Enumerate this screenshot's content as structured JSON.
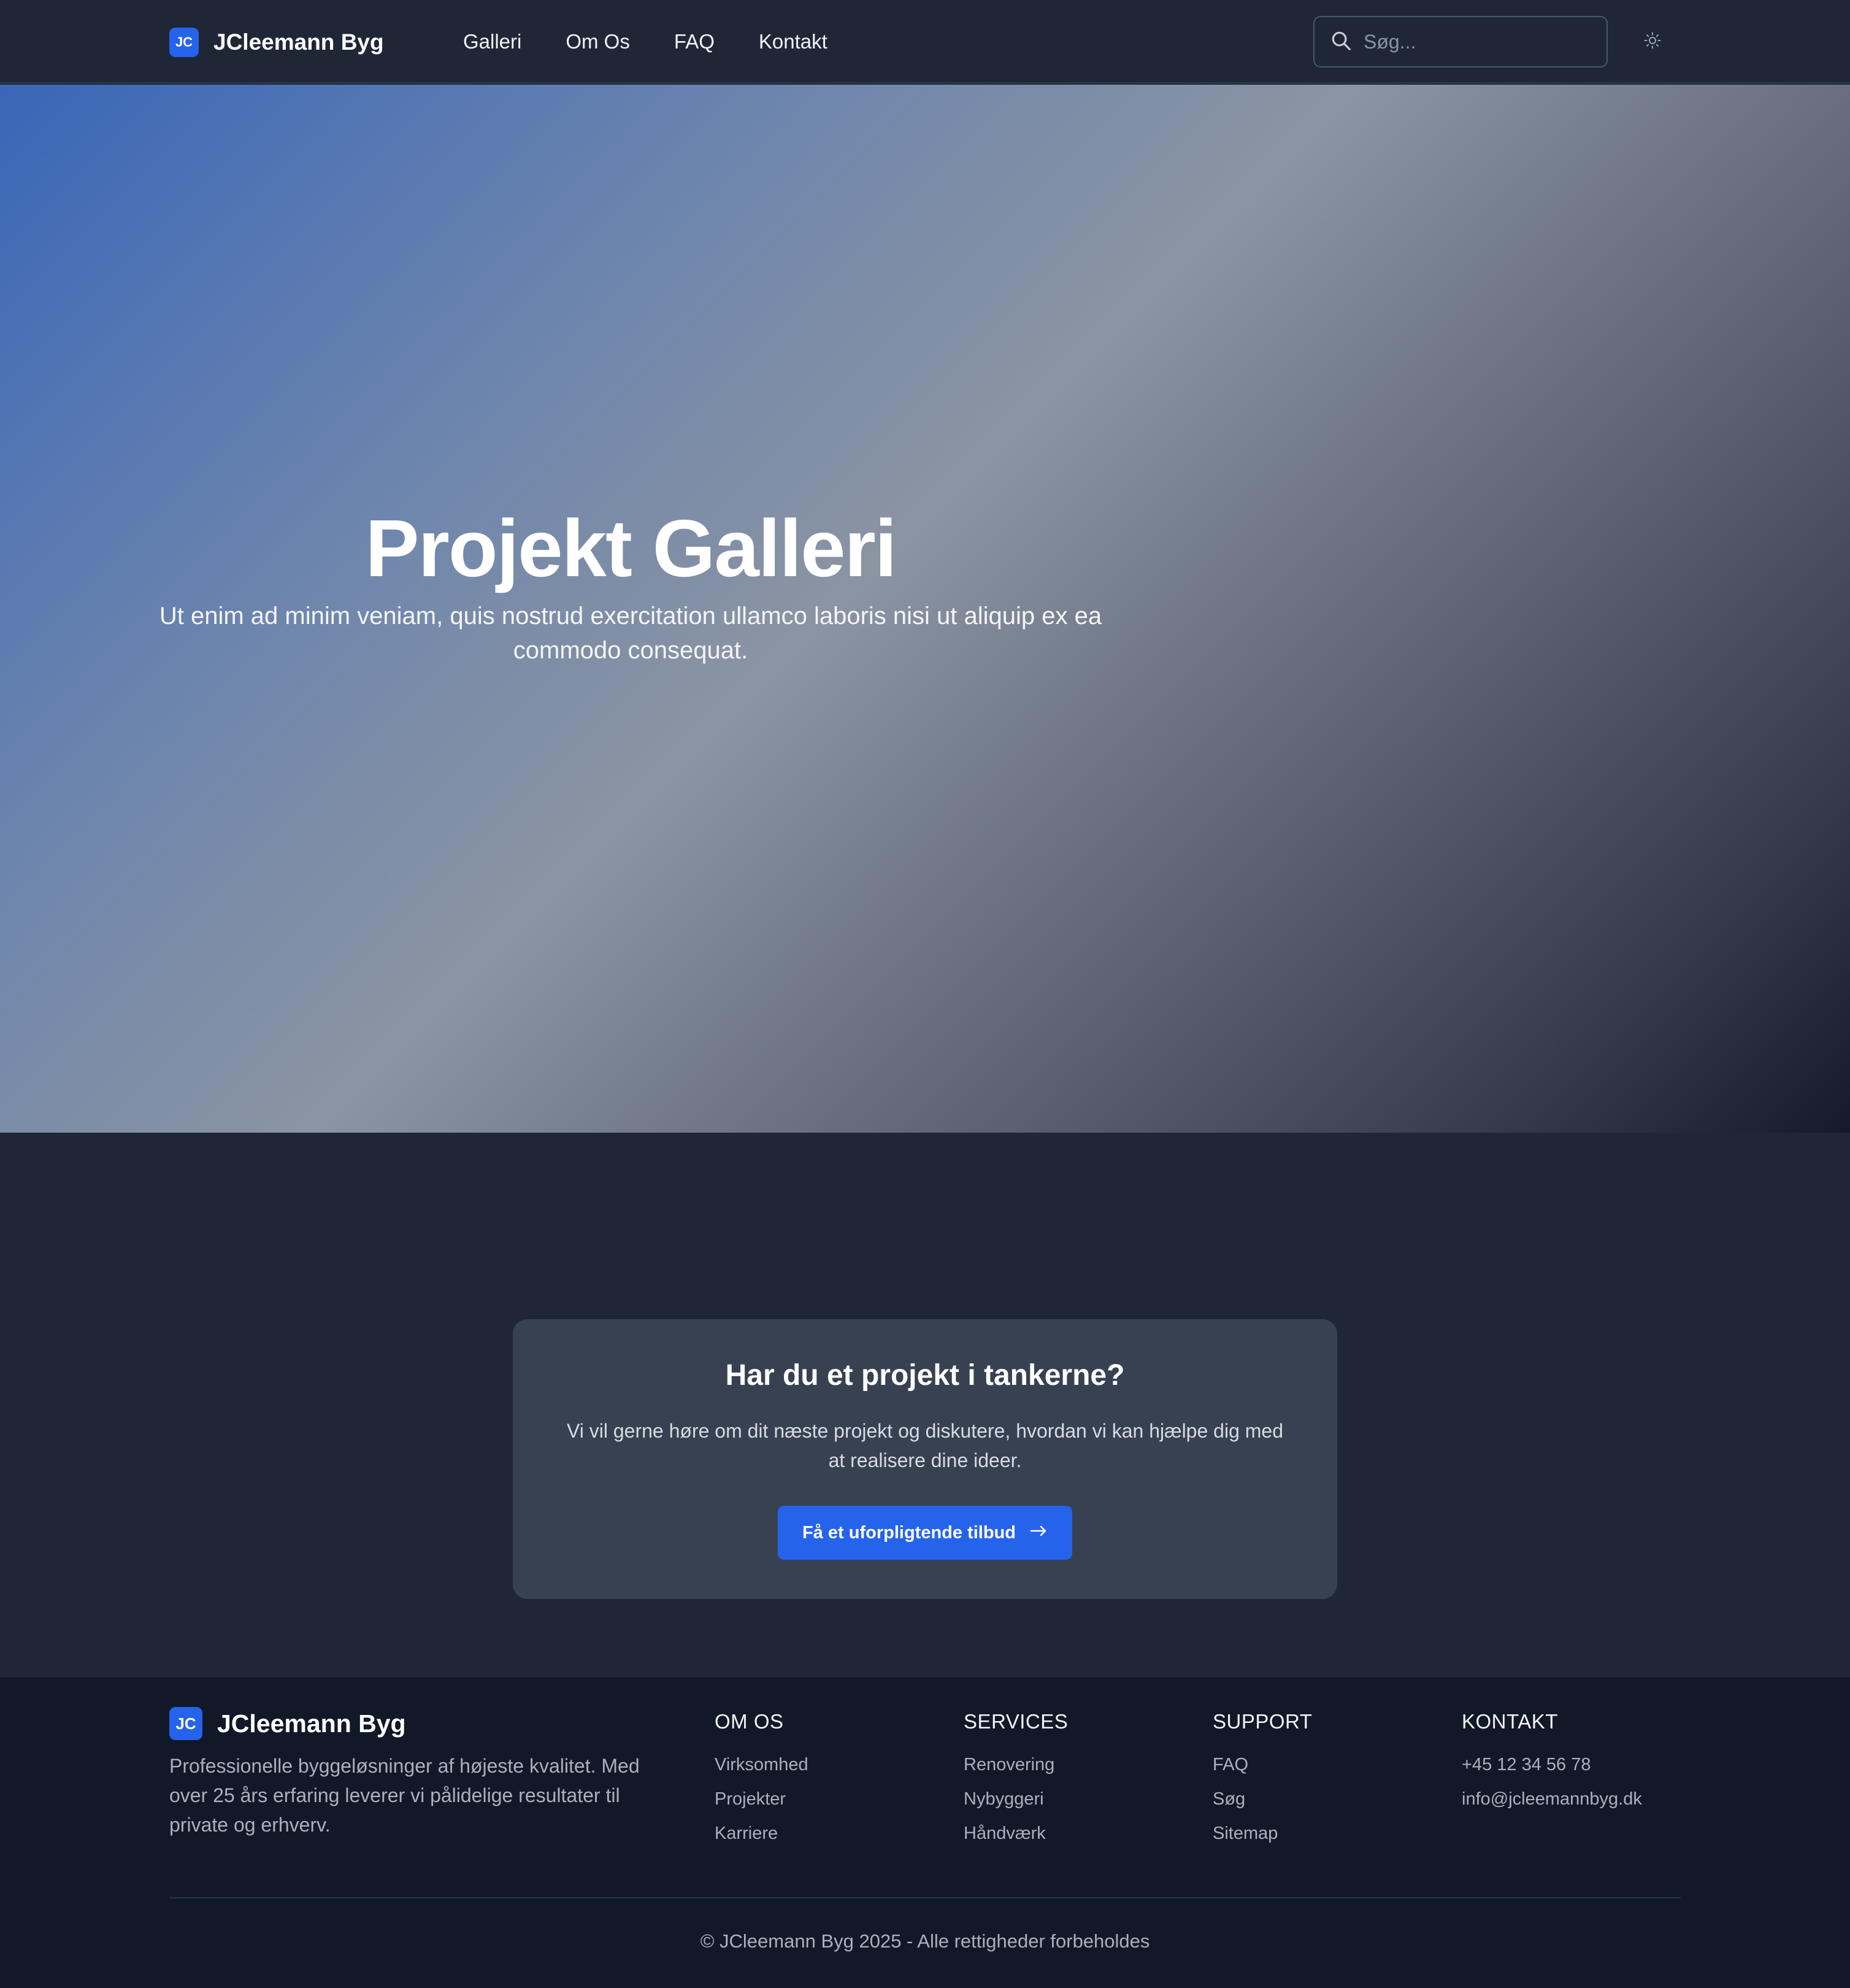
{
  "header": {
    "logo_badge": "JC",
    "logo_text": "JCleemann Byg",
    "nav": [
      {
        "label": "Galleri"
      },
      {
        "label": "Om Os"
      },
      {
        "label": "FAQ"
      },
      {
        "label": "Kontakt"
      }
    ],
    "search_placeholder": "Søg...",
    "search_icon": "search-icon",
    "theme_icon": "sun-icon"
  },
  "hero": {
    "title": "Projekt Galleri",
    "subtitle": "Ut enim ad minim veniam, quis nostrud exercitation ullamco laboris nisi ut aliquip ex ea commodo consequat."
  },
  "cta": {
    "title": "Har du et projekt i tankerne?",
    "text": "Vi vil gerne høre om dit næste projekt og diskutere, hvordan vi kan hjælpe dig med at realisere dine ideer.",
    "button_label": "Få et uforpligtende tilbud",
    "button_icon": "arrow-right-icon"
  },
  "footer": {
    "logo_badge": "JC",
    "logo_text": "JCleemann Byg",
    "description": "Professionelle byggeløsninger af højeste kvalitet. Med over 25 års erfaring leverer vi pålidelige resultater til private og erhverv.",
    "columns": [
      {
        "title": "OM OS",
        "links": [
          "Virksomhed",
          "Projekter",
          "Karriere"
        ]
      },
      {
        "title": "SERVICES",
        "links": [
          "Renovering",
          "Nybyggeri",
          "Håndværk"
        ]
      },
      {
        "title": "SUPPORT",
        "links": [
          "FAQ",
          "Søg",
          "Sitemap"
        ]
      },
      {
        "title": "KONTAKT",
        "links": [
          "+45 12 34 56 78",
          "info@jcleemannbyg.dk"
        ]
      }
    ],
    "copyright": "© JCleemann Byg 2025 - Alle rettigheder forbeholdes"
  },
  "colors": {
    "accent": "#2563eb",
    "header_bg": "#1f2737",
    "card_bg": "#374151",
    "footer_bg": "#111827"
  }
}
